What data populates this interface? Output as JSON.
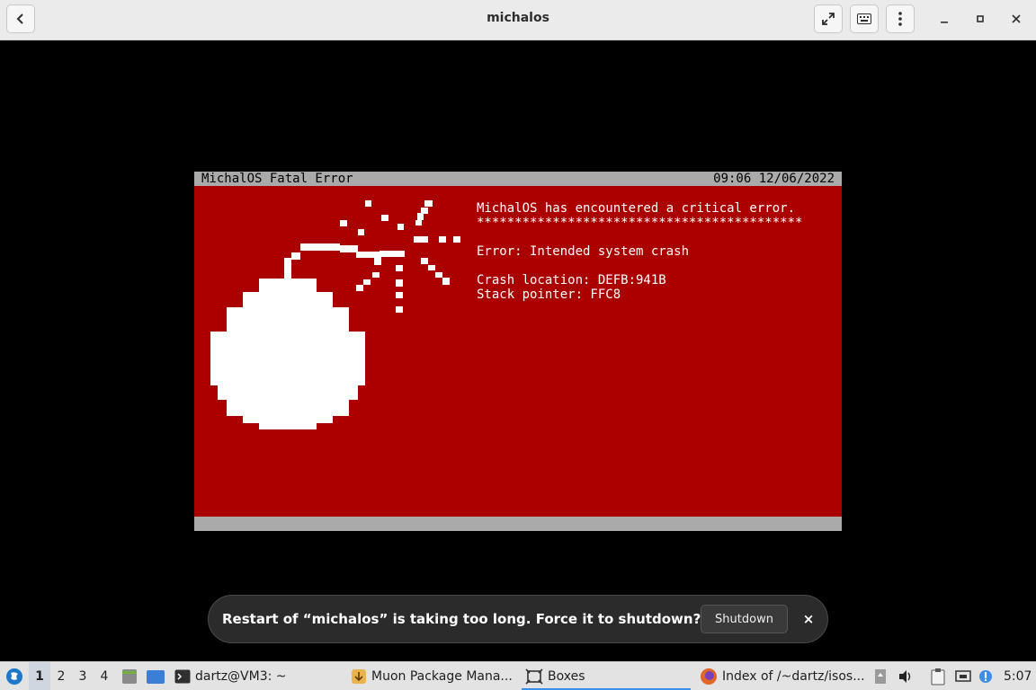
{
  "window": {
    "title": "michalos"
  },
  "vm_screen": {
    "top_bar_title": "MichalOS Fatal Error",
    "top_bar_clock": "09:06 12/06/2022",
    "message": "MichalOS has encountered a critical error.",
    "stars": "*******************************************",
    "error_line": "Error: Intended system crash",
    "crash_location": "Crash location: DEFB:941B",
    "stack_pointer": "Stack pointer: FFC8",
    "icon": "bomb-icon",
    "colors": {
      "background": "#aa0000",
      "bar": "#aaaaaa",
      "text": "#ffffff"
    }
  },
  "notification": {
    "message": "Restart of “michalos” is taking too long. Force it to shutdown?",
    "button_label": "Shutdown",
    "close_label": "×"
  },
  "taskbar": {
    "workspaces": [
      "1",
      "2",
      "3",
      "4"
    ],
    "active_workspace": "1",
    "tasks": [
      {
        "label": "dartz@VM3: ~",
        "icon": "terminal-icon"
      },
      {
        "label": "Muon Package Mana...",
        "icon": "package-manager-icon"
      },
      {
        "label": "Boxes",
        "icon": "boxes-icon",
        "active": true
      },
      {
        "label": "Index of /~dartz/isos...",
        "icon": "firefox-icon"
      }
    ],
    "clock": "5:07"
  }
}
